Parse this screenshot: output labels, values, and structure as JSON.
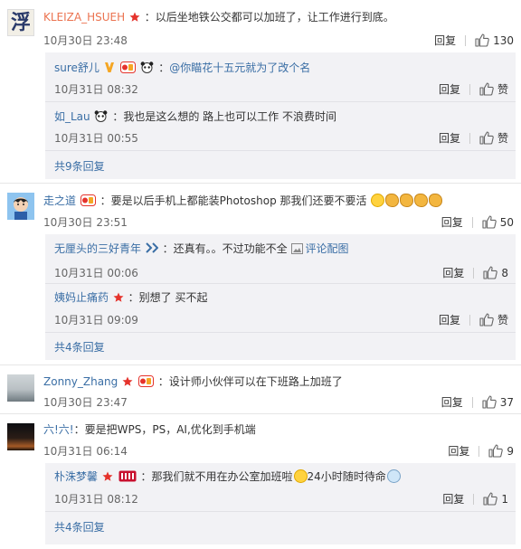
{
  "actions": {
    "reply": "回复"
  },
  "comments": [
    {
      "user": "KLEIZA_HSUEH",
      "text": "：以后坐地铁公交都可以加班了，让工作进行到底。",
      "date": "10月30日 23:48",
      "likes": "130",
      "replies": [
        {
          "user": "sure舒儿",
          "mention": "@你瞄花十五元就为了改个名",
          "text": "：",
          "date": "10月31日 08:32",
          "likes": "赞"
        },
        {
          "user": "如_Lau",
          "text": "：我也是这么想的 路上也可以工作 不浪费时间",
          "date": "10月31日 00:55",
          "likes": "赞"
        }
      ],
      "more": "共9条回复"
    },
    {
      "user": "走之道",
      "text": "：要是以后手机上都能装Photoshop 那我们还要不要活",
      "date": "10月30日 23:51",
      "likes": "50",
      "replies": [
        {
          "user": "无厘头的三好青年",
          "text": "：还真有。。不过功能不全",
          "picture_link": "评论配图",
          "date": "10月31日 00:06",
          "likes": "8"
        },
        {
          "user": "姨妈止痛药",
          "text": "：别想了 买不起",
          "date": "10月31日 09:09",
          "likes": "赞"
        }
      ],
      "more": "共4条回复"
    },
    {
      "user": "Zonny_Zhang",
      "text": "：设计师小伙伴可以在下班路上加班了",
      "date": "10月30日 23:47",
      "likes": "37"
    },
    {
      "user": "六!六!",
      "text": "：要是把WPS，PS，AI,优化到手机端",
      "date": "10月31日 06:14",
      "likes": "9",
      "replies": [
        {
          "user": "朴洙梦馨",
          "text": "：那我们就不用在办公室加班啦",
          "text_after": "24小时随时待命",
          "date": "10月31日 08:12",
          "likes": "1"
        }
      ],
      "more": "共4条回复"
    }
  ],
  "colors": {
    "username": "#eb7350",
    "link": "#3a6ea5",
    "reply_bg": "#f2f2f5"
  }
}
